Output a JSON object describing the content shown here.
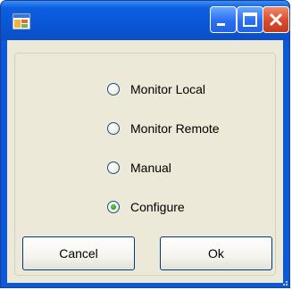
{
  "window": {
    "title": "",
    "icon": "app-window-icon",
    "controls": [
      "minimize-icon",
      "maximize-icon",
      "close-icon"
    ]
  },
  "options": [
    {
      "label": "Monitor Local",
      "selected": false
    },
    {
      "label": "Monitor Remote",
      "selected": false
    },
    {
      "label": "Manual",
      "selected": false
    },
    {
      "label": "Configure",
      "selected": true
    }
  ],
  "buttons": {
    "cancel_label": "Cancel",
    "ok_label": "Ok"
  },
  "colors": {
    "titlebar": "#0b59d8",
    "client": "#ece9d8",
    "close_button": "#d9492a",
    "radio_selected": "#21a121"
  }
}
